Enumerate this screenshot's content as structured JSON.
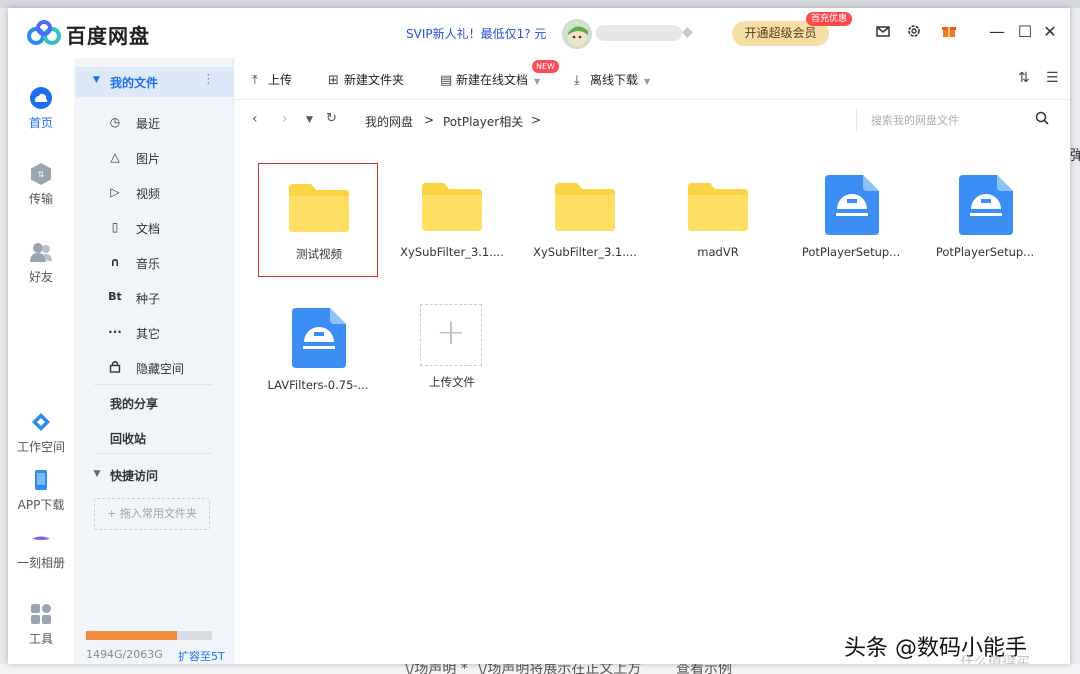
{
  "app": {
    "name": "百度网盘"
  },
  "header": {
    "promo": "SVIP新人礼！最低仅1? 元",
    "vip_button": "开通超级会员",
    "vip_badge": "首充优惠"
  },
  "rail": [
    {
      "label": "首页",
      "icon": "home-cloud-icon",
      "active": true
    },
    {
      "label": "传输",
      "icon": "transfer-icon"
    },
    {
      "label": "好友",
      "icon": "friends-icon"
    },
    {
      "label": "工作空间",
      "icon": "workspace-icon"
    },
    {
      "label": "APP下载",
      "icon": "phone-icon"
    },
    {
      "label": "一刻相册",
      "icon": "album-icon"
    },
    {
      "label": "工具",
      "icon": "tools-icon"
    }
  ],
  "sidebar": {
    "root_label": "我的文件",
    "items": [
      {
        "label": "最近",
        "icon": "clock-icon"
      },
      {
        "label": "图片",
        "icon": "image-icon"
      },
      {
        "label": "视频",
        "icon": "video-icon"
      },
      {
        "label": "文档",
        "icon": "document-icon"
      },
      {
        "label": "音乐",
        "icon": "headphones-icon"
      },
      {
        "label": "种子",
        "icon": "torrent-icon"
      },
      {
        "label": "其它",
        "icon": "more-icon"
      },
      {
        "label": "隐藏空间",
        "icon": "lock-icon"
      }
    ],
    "my_share": "我的分享",
    "recycle": "回收站",
    "quick_access": "快捷访问",
    "quick_drop": "+ 拖入常用文件夹",
    "storage_text": "1494G/2063G",
    "storage_fraction": 0.7242,
    "expand": "扩容至5T"
  },
  "toolbar": {
    "upload": "上传",
    "new_folder": "新建文件夹",
    "new_doc": "新建在线文档",
    "new_badge": "NEW",
    "offline": "离线下载"
  },
  "breadcrumb": {
    "root": "我的网盘",
    "current": "PotPlayer相关",
    "sep": ">"
  },
  "search": {
    "placeholder": "搜索我的网盘文件"
  },
  "files": [
    {
      "name": "测试视频",
      "type": "folder",
      "selected": true
    },
    {
      "name": "XySubFilter_3.1....",
      "type": "folder"
    },
    {
      "name": "XySubFilter_3.1....",
      "type": "folder"
    },
    {
      "name": "madVR",
      "type": "folder"
    },
    {
      "name": "PotPlayerSetup...",
      "type": "package"
    },
    {
      "name": "PotPlayerSetup...",
      "type": "package"
    },
    {
      "name": "LAVFilters-0.75-...",
      "type": "package"
    }
  ],
  "upload_tile": "上传文件",
  "watermark": "头条 @数码小能手",
  "watermark_faint": "什么值得买",
  "background": {
    "bottom_text_1": "\\/场声明 *",
    "bottom_text_2": "\\/场声明将展示在正文上方",
    "bottom_text_3": "查看示例",
    "right_char": "弹"
  },
  "colors": {
    "accent": "#1e6ff0",
    "folder": "#fcd443",
    "package": "#3c8ef5",
    "selected_border": "#d62f2f"
  }
}
